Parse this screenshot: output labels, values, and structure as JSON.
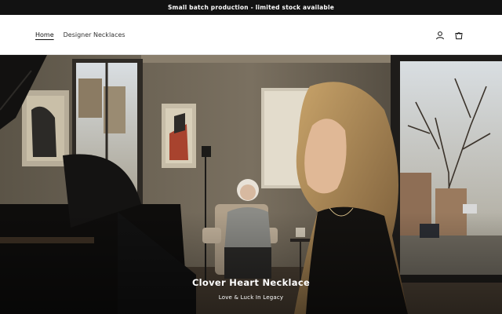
{
  "announcement": {
    "text": "Small batch production - limited stock available"
  },
  "header": {
    "nav": [
      {
        "label": "Home",
        "active": true
      },
      {
        "label": "Designer Necklaces",
        "active": false
      }
    ],
    "icons": {
      "account": "account-icon",
      "cart": "cart-icon"
    }
  },
  "hero": {
    "title": "Clover Heart Necklace",
    "subtitle": "Love & Luck In Legacy"
  },
  "colors": {
    "announcement_bg": "#121212",
    "header_bg": "#ffffff",
    "text_dark": "#121212",
    "hero_text": "#ffffff"
  }
}
